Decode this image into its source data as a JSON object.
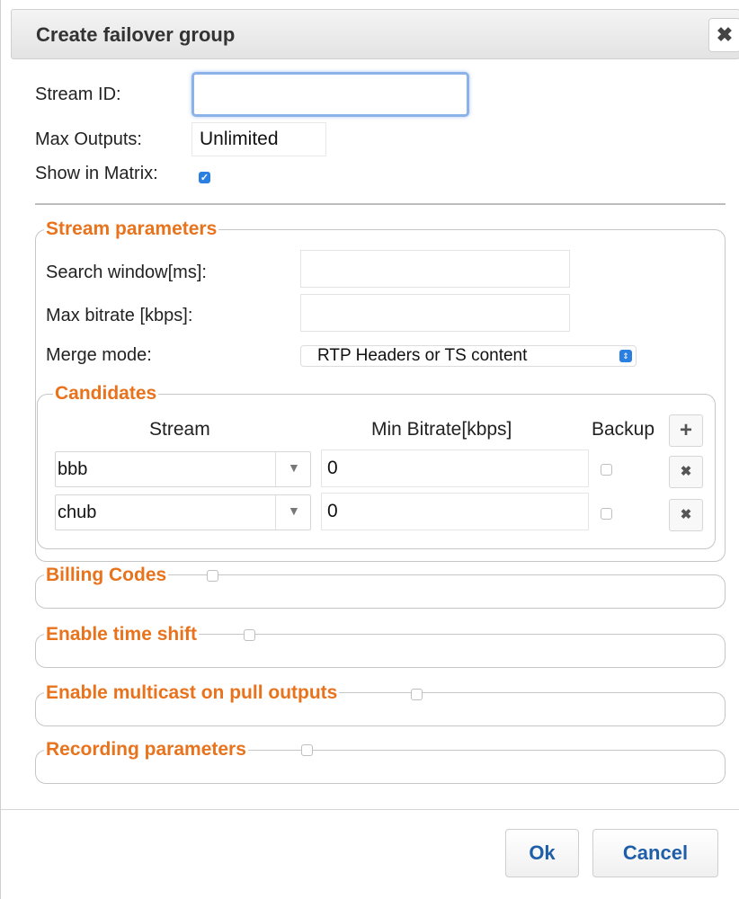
{
  "dialog": {
    "title": "Create failover group",
    "close_icon": "✖"
  },
  "form": {
    "stream_id_label": "Stream ID:",
    "stream_id_value": "",
    "max_outputs_label": "Max Outputs:",
    "max_outputs_value": "Unlimited",
    "show_in_matrix_label": "Show in Matrix:",
    "show_in_matrix_checked": true
  },
  "stream_parameters": {
    "legend": "Stream parameters",
    "search_window_label": "Search window[ms]:",
    "search_window_value": "",
    "max_bitrate_label": "Max bitrate [kbps]:",
    "max_bitrate_value": "",
    "merge_mode_label": "Merge mode:",
    "merge_mode_value": "RTP Headers or TS content"
  },
  "candidates": {
    "legend": "Candidates",
    "headers": {
      "stream": "Stream",
      "min_bitrate": "Min Bitrate[kbps]",
      "backup": "Backup"
    },
    "add_icon": "+",
    "remove_icon": "✖",
    "rows": [
      {
        "stream": "bbb",
        "min_bitrate": "0",
        "backup": false
      },
      {
        "stream": "chub",
        "min_bitrate": "0",
        "backup": false
      }
    ]
  },
  "sections": {
    "billing_codes": "Billing Codes",
    "time_shift": "Enable time shift",
    "multicast": "Enable multicast on pull outputs",
    "recording": "Recording parameters"
  },
  "buttons": {
    "ok": "Ok",
    "cancel": "Cancel"
  },
  "colors": {
    "accent": "#e8731c",
    "link": "#1f5ea8",
    "focus": "#8cb2ea",
    "checkbox": "#2a7fe0"
  }
}
